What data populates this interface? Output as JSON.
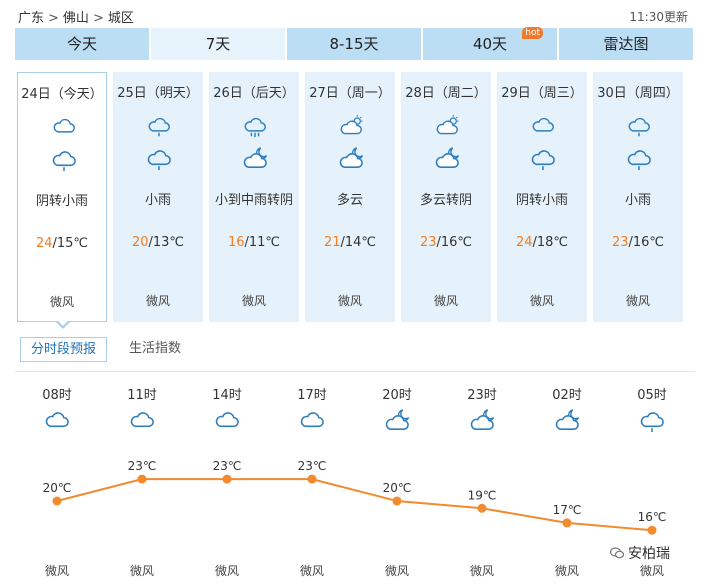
{
  "breadcrumb": {
    "province": "广东",
    "city": "佛山",
    "district": "城区",
    "sep": ">"
  },
  "updated": "11:30更新",
  "tabs": [
    {
      "label": "今天",
      "active": false
    },
    {
      "label": "7天",
      "active": true
    },
    {
      "label": "8-15天",
      "active": false
    },
    {
      "label": "40天",
      "active": false,
      "badge": "hot"
    },
    {
      "label": "雷达图",
      "active": false
    }
  ],
  "days": [
    {
      "date": "24日（今天）",
      "icons": [
        "cloudy",
        "light-rain"
      ],
      "weather": "阴转小雨",
      "high": "24",
      "low": "/15℃",
      "wind": "微风"
    },
    {
      "date": "25日（明天）",
      "icons": [
        "light-rain",
        "light-rain"
      ],
      "weather": "小雨",
      "high": "20",
      "low": "/13℃",
      "wind": "微风"
    },
    {
      "date": "26日（后天）",
      "icons": [
        "moderate-rain",
        "cloudy-night"
      ],
      "weather": "小到中雨转阴",
      "high": "16",
      "low": "/11℃",
      "wind": "微风"
    },
    {
      "date": "27日（周一）",
      "icons": [
        "partly-cloudy-day",
        "partly-cloudy-night"
      ],
      "weather": "多云",
      "high": "21",
      "low": "/14℃",
      "wind": "微风"
    },
    {
      "date": "28日（周二）",
      "icons": [
        "partly-cloudy-day",
        "cloudy-night"
      ],
      "weather": "多云转阴",
      "high": "23",
      "low": "/16℃",
      "wind": "微风"
    },
    {
      "date": "29日（周三）",
      "icons": [
        "cloudy",
        "light-rain"
      ],
      "weather": "阴转小雨",
      "high": "24",
      "low": "/18℃",
      "wind": "微风"
    },
    {
      "date": "30日（周四）",
      "icons": [
        "light-rain",
        "light-rain"
      ],
      "weather": "小雨",
      "high": "23",
      "low": "/16℃",
      "wind": "微风"
    }
  ],
  "subtabs": [
    {
      "label": "分时段预报",
      "active": true
    },
    {
      "label": "生活指数",
      "active": false
    }
  ],
  "hourly": [
    {
      "time": "08时",
      "icon": "cloudy",
      "temp": "20℃",
      "wind": "微风"
    },
    {
      "time": "11时",
      "icon": "cloudy",
      "temp": "23℃",
      "wind": "微风"
    },
    {
      "time": "14时",
      "icon": "cloudy",
      "temp": "23℃",
      "wind": "微风"
    },
    {
      "time": "17时",
      "icon": "cloudy",
      "temp": "23℃",
      "wind": "微风"
    },
    {
      "time": "20时",
      "icon": "cloudy-night",
      "temp": "20℃",
      "wind": "微风"
    },
    {
      "time": "23时",
      "icon": "cloudy-night",
      "temp": "19℃",
      "wind": "微风"
    },
    {
      "time": "02时",
      "icon": "cloudy-night",
      "temp": "17℃",
      "wind": "微风"
    },
    {
      "time": "05时",
      "icon": "light-rain",
      "temp": "16℃",
      "wind": "微风"
    }
  ],
  "chart_data": {
    "type": "line",
    "x": [
      "08时",
      "11时",
      "14时",
      "17时",
      "20时",
      "23时",
      "02时",
      "05时"
    ],
    "series": [
      {
        "values": [
          20,
          23,
          23,
          23,
          20,
          19,
          17,
          16
        ]
      }
    ],
    "data_labels": [
      "20℃",
      "23℃",
      "23℃",
      "23℃",
      "20℃",
      "19℃",
      "17℃",
      "16℃"
    ],
    "color": "#f28a2e"
  },
  "colors": {
    "tab_bg": "#bcdef5",
    "day_bg": "#e6f2fb",
    "high_temp": "#f57d1f",
    "icon": "#2e7dbd",
    "line": "#f28a2e"
  },
  "watermark": "安柏瑞"
}
